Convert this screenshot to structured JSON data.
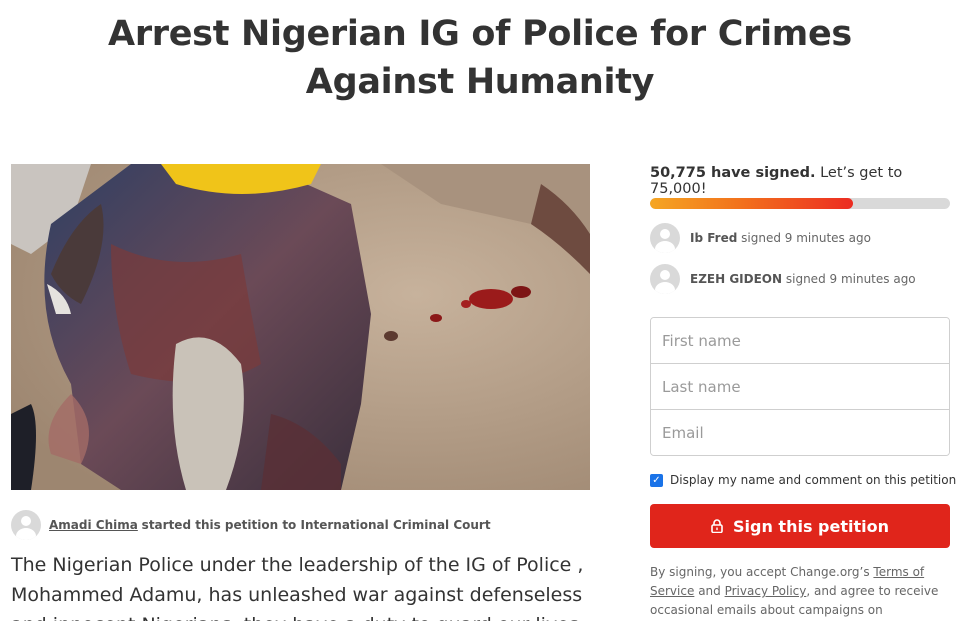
{
  "petition": {
    "title": "Arrest Nigerian IG of Police for Crimes Against Humanity",
    "starter_name": "Amadi Chima",
    "starter_suffix": "started this petition to International Criminal Court",
    "body": "The Nigerian Police under the leadership of the IG of Police , Mohammed Adamu, has unleashed  war against defenseless and innocent Nigerians; they have a duty to guard our lives"
  },
  "media": {
    "icon": "petition-photo",
    "colors": {
      "ground": "#b79f8a",
      "helmet": "#f0c419",
      "jeans": "#3a4f78",
      "blood": "#9b1b1b"
    }
  },
  "signatures": {
    "count_text": "50,775 have signed.",
    "goal_text": "Let’s get to 75,000!",
    "signed": 50775,
    "goal": 75000,
    "progress_colors": {
      "start": "#f5a623",
      "end": "#ec2c22",
      "track": "#d9d9d9"
    }
  },
  "recent_signers": [
    {
      "name": "Ib Fred",
      "action": "signed 9 minutes ago"
    },
    {
      "name": "EZEH GIDEON",
      "action": "signed 9 minutes ago"
    }
  ],
  "form": {
    "first_name_placeholder": "First name",
    "last_name_placeholder": "Last name",
    "email_placeholder": "Email",
    "display_consent": "Display my name and comment on this petition",
    "consent_checked": true
  },
  "sign_button": {
    "label": "Sign this petition",
    "icon": "lock-icon",
    "color": "#e0251b"
  },
  "terms": {
    "prefix": "By signing, you accept Change.org’s",
    "terms_link": "Terms of Service",
    "and": "and",
    "privacy_link": "Privacy Policy",
    "suffix": ", and agree to receive occasional emails about campaigns on Change.org."
  }
}
